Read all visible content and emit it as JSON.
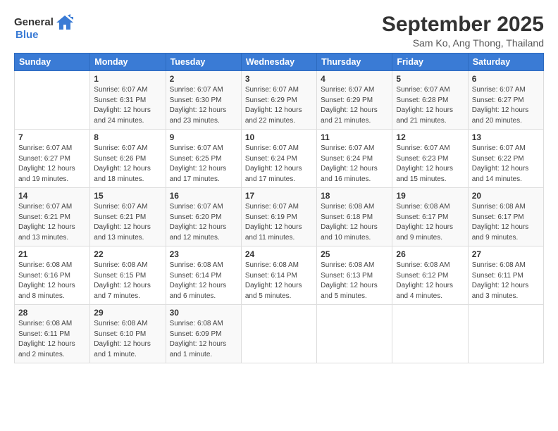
{
  "logo": {
    "general": "General",
    "blue": "Blue"
  },
  "title": "September 2025",
  "location": "Sam Ko, Ang Thong, Thailand",
  "days_header": [
    "Sunday",
    "Monday",
    "Tuesday",
    "Wednesday",
    "Thursday",
    "Friday",
    "Saturday"
  ],
  "weeks": [
    [
      {
        "day": "",
        "sunrise": "",
        "sunset": "",
        "daylight": ""
      },
      {
        "day": "1",
        "sunrise": "Sunrise: 6:07 AM",
        "sunset": "Sunset: 6:31 PM",
        "daylight": "Daylight: 12 hours and 24 minutes."
      },
      {
        "day": "2",
        "sunrise": "Sunrise: 6:07 AM",
        "sunset": "Sunset: 6:30 PM",
        "daylight": "Daylight: 12 hours and 23 minutes."
      },
      {
        "day": "3",
        "sunrise": "Sunrise: 6:07 AM",
        "sunset": "Sunset: 6:29 PM",
        "daylight": "Daylight: 12 hours and 22 minutes."
      },
      {
        "day": "4",
        "sunrise": "Sunrise: 6:07 AM",
        "sunset": "Sunset: 6:29 PM",
        "daylight": "Daylight: 12 hours and 21 minutes."
      },
      {
        "day": "5",
        "sunrise": "Sunrise: 6:07 AM",
        "sunset": "Sunset: 6:28 PM",
        "daylight": "Daylight: 12 hours and 21 minutes."
      },
      {
        "day": "6",
        "sunrise": "Sunrise: 6:07 AM",
        "sunset": "Sunset: 6:27 PM",
        "daylight": "Daylight: 12 hours and 20 minutes."
      }
    ],
    [
      {
        "day": "7",
        "sunrise": "Sunrise: 6:07 AM",
        "sunset": "Sunset: 6:27 PM",
        "daylight": "Daylight: 12 hours and 19 minutes."
      },
      {
        "day": "8",
        "sunrise": "Sunrise: 6:07 AM",
        "sunset": "Sunset: 6:26 PM",
        "daylight": "Daylight: 12 hours and 18 minutes."
      },
      {
        "day": "9",
        "sunrise": "Sunrise: 6:07 AM",
        "sunset": "Sunset: 6:25 PM",
        "daylight": "Daylight: 12 hours and 17 minutes."
      },
      {
        "day": "10",
        "sunrise": "Sunrise: 6:07 AM",
        "sunset": "Sunset: 6:24 PM",
        "daylight": "Daylight: 12 hours and 17 minutes."
      },
      {
        "day": "11",
        "sunrise": "Sunrise: 6:07 AM",
        "sunset": "Sunset: 6:24 PM",
        "daylight": "Daylight: 12 hours and 16 minutes."
      },
      {
        "day": "12",
        "sunrise": "Sunrise: 6:07 AM",
        "sunset": "Sunset: 6:23 PM",
        "daylight": "Daylight: 12 hours and 15 minutes."
      },
      {
        "day": "13",
        "sunrise": "Sunrise: 6:07 AM",
        "sunset": "Sunset: 6:22 PM",
        "daylight": "Daylight: 12 hours and 14 minutes."
      }
    ],
    [
      {
        "day": "14",
        "sunrise": "Sunrise: 6:07 AM",
        "sunset": "Sunset: 6:21 PM",
        "daylight": "Daylight: 12 hours and 13 minutes."
      },
      {
        "day": "15",
        "sunrise": "Sunrise: 6:07 AM",
        "sunset": "Sunset: 6:21 PM",
        "daylight": "Daylight: 12 hours and 13 minutes."
      },
      {
        "day": "16",
        "sunrise": "Sunrise: 6:07 AM",
        "sunset": "Sunset: 6:20 PM",
        "daylight": "Daylight: 12 hours and 12 minutes."
      },
      {
        "day": "17",
        "sunrise": "Sunrise: 6:07 AM",
        "sunset": "Sunset: 6:19 PM",
        "daylight": "Daylight: 12 hours and 11 minutes."
      },
      {
        "day": "18",
        "sunrise": "Sunrise: 6:08 AM",
        "sunset": "Sunset: 6:18 PM",
        "daylight": "Daylight: 12 hours and 10 minutes."
      },
      {
        "day": "19",
        "sunrise": "Sunrise: 6:08 AM",
        "sunset": "Sunset: 6:17 PM",
        "daylight": "Daylight: 12 hours and 9 minutes."
      },
      {
        "day": "20",
        "sunrise": "Sunrise: 6:08 AM",
        "sunset": "Sunset: 6:17 PM",
        "daylight": "Daylight: 12 hours and 9 minutes."
      }
    ],
    [
      {
        "day": "21",
        "sunrise": "Sunrise: 6:08 AM",
        "sunset": "Sunset: 6:16 PM",
        "daylight": "Daylight: 12 hours and 8 minutes."
      },
      {
        "day": "22",
        "sunrise": "Sunrise: 6:08 AM",
        "sunset": "Sunset: 6:15 PM",
        "daylight": "Daylight: 12 hours and 7 minutes."
      },
      {
        "day": "23",
        "sunrise": "Sunrise: 6:08 AM",
        "sunset": "Sunset: 6:14 PM",
        "daylight": "Daylight: 12 hours and 6 minutes."
      },
      {
        "day": "24",
        "sunrise": "Sunrise: 6:08 AM",
        "sunset": "Sunset: 6:14 PM",
        "daylight": "Daylight: 12 hours and 5 minutes."
      },
      {
        "day": "25",
        "sunrise": "Sunrise: 6:08 AM",
        "sunset": "Sunset: 6:13 PM",
        "daylight": "Daylight: 12 hours and 5 minutes."
      },
      {
        "day": "26",
        "sunrise": "Sunrise: 6:08 AM",
        "sunset": "Sunset: 6:12 PM",
        "daylight": "Daylight: 12 hours and 4 minutes."
      },
      {
        "day": "27",
        "sunrise": "Sunrise: 6:08 AM",
        "sunset": "Sunset: 6:11 PM",
        "daylight": "Daylight: 12 hours and 3 minutes."
      }
    ],
    [
      {
        "day": "28",
        "sunrise": "Sunrise: 6:08 AM",
        "sunset": "Sunset: 6:11 PM",
        "daylight": "Daylight: 12 hours and 2 minutes."
      },
      {
        "day": "29",
        "sunrise": "Sunrise: 6:08 AM",
        "sunset": "Sunset: 6:10 PM",
        "daylight": "Daylight: 12 hours and 1 minute."
      },
      {
        "day": "30",
        "sunrise": "Sunrise: 6:08 AM",
        "sunset": "Sunset: 6:09 PM",
        "daylight": "Daylight: 12 hours and 1 minute."
      },
      {
        "day": "",
        "sunrise": "",
        "sunset": "",
        "daylight": ""
      },
      {
        "day": "",
        "sunrise": "",
        "sunset": "",
        "daylight": ""
      },
      {
        "day": "",
        "sunrise": "",
        "sunset": "",
        "daylight": ""
      },
      {
        "day": "",
        "sunrise": "",
        "sunset": "",
        "daylight": ""
      }
    ]
  ]
}
